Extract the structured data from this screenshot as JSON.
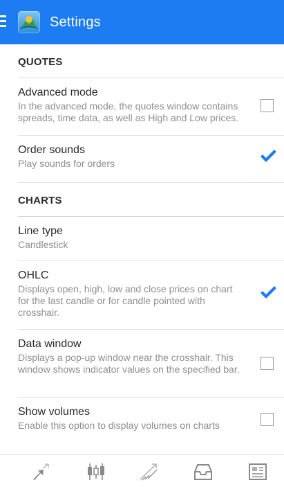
{
  "app_bar": {
    "title": "Settings",
    "icons": [
      "menu-icon",
      "metatrader-logo-icon"
    ]
  },
  "sections": [
    {
      "header": "QUOTES",
      "items": [
        {
          "title": "Advanced mode",
          "description": "In the advanced mode, the quotes window contains spreads, time data, as well as High and Low prices.",
          "checkbox": true,
          "checked": false
        },
        {
          "title": "Order sounds",
          "description": "Play sounds for orders",
          "checkbox": true,
          "checked": true
        }
      ]
    },
    {
      "header": "CHARTS",
      "items": [
        {
          "title": "Line type",
          "description": "Candlestick",
          "checkbox": false
        },
        {
          "title": "OHLC",
          "description": "Displays open, high, low and close prices on chart for the last candle or for candle pointed with crosshair.",
          "checkbox": true,
          "checked": true
        },
        {
          "title": "Data window",
          "description": "Displays a pop-up window near the crosshair. This window shows indicator values on the specified bar.",
          "checkbox": true,
          "checked": false
        },
        {
          "title": "Show volumes",
          "description": "Enable this option to display volumes on charts",
          "checkbox": true,
          "checked": false
        }
      ]
    }
  ],
  "bottom_nav": [
    {
      "icon": "quotes-arrows-icon"
    },
    {
      "icon": "chart-candles-icon"
    },
    {
      "icon": "trade-icon"
    },
    {
      "icon": "history-inbox-icon"
    },
    {
      "icon": "news-icon"
    }
  ],
  "colors": {
    "app_bar": "#1e7cf2",
    "check": "#1e7cf2",
    "nav_icon": "#8a8a8a"
  }
}
